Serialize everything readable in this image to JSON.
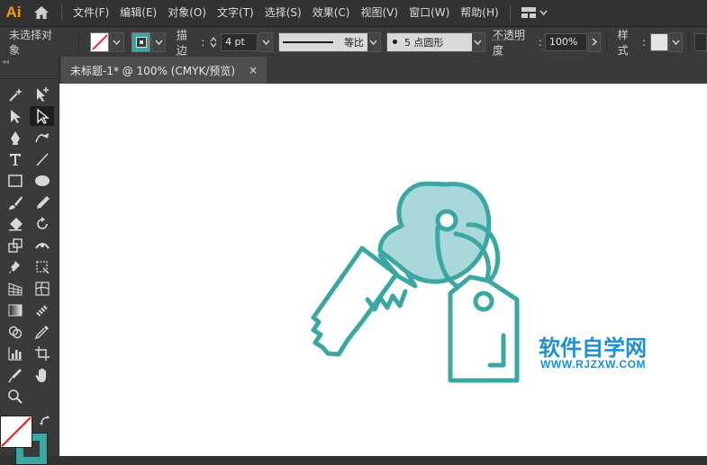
{
  "app": {
    "logo": "Ai",
    "logo_color": "#ff9a00"
  },
  "menu": {
    "items": [
      "文件(F)",
      "编辑(E)",
      "对象(O)",
      "文字(T)",
      "选择(S)",
      "效果(C)",
      "视图(V)",
      "窗口(W)",
      "帮助(H)"
    ],
    "icons": [
      "home-icon",
      "workspace-switcher-icon"
    ]
  },
  "control_bar": {
    "selection_status": "未选择对象",
    "stroke_label": "描边",
    "stroke_weight": "4 pt",
    "stroke_profile": "等比",
    "brush_label": "5 点圆形",
    "opacity_label": "不透明度",
    "opacity_value": "100%",
    "style_label": "样式"
  },
  "document": {
    "tab_title": "未标题-1* @ 100% (CMYK/预览)",
    "tab_close": "×"
  },
  "artwork": {
    "stroke_color": "#3aa7a3",
    "fill_color": "#a8d8da"
  },
  "watermark": {
    "title": "软件自学网",
    "url": "WWW.RJZXW.COM",
    "color": "#1e8fd6"
  },
  "colors": {
    "fill_swatch": "#ffffff",
    "stroke_swatch": "#3aa7a3",
    "none_slash": "#e02020"
  }
}
